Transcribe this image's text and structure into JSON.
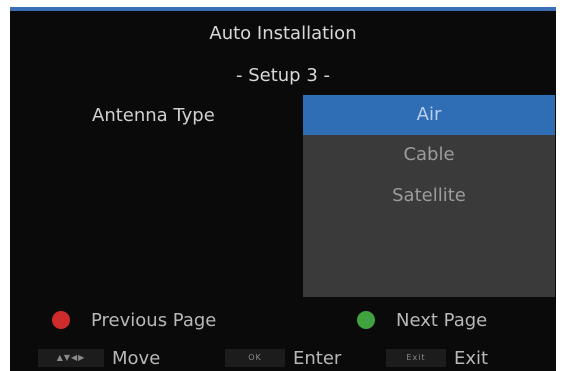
{
  "header": {
    "title": "Auto Installation",
    "subtitle": "- Setup 3 -"
  },
  "setting": {
    "label": "Antenna Type",
    "options": [
      "Air",
      "Cable",
      "Satellite"
    ],
    "selected": "Air"
  },
  "colored_hints": {
    "previous": {
      "label": "Previous Page",
      "color": "#d02b2b"
    },
    "next": {
      "label": "Next Page",
      "color": "#3fa33f"
    }
  },
  "key_hints": {
    "move": {
      "key": "▲▼◀▶",
      "label": "Move"
    },
    "enter": {
      "key": "OK",
      "label": "Enter"
    },
    "exit": {
      "key": "Exit",
      "label": "Exit"
    }
  },
  "colors": {
    "accent": "#2f6db5",
    "panel": "#3a3a3a",
    "background": "#0a0a0a"
  }
}
